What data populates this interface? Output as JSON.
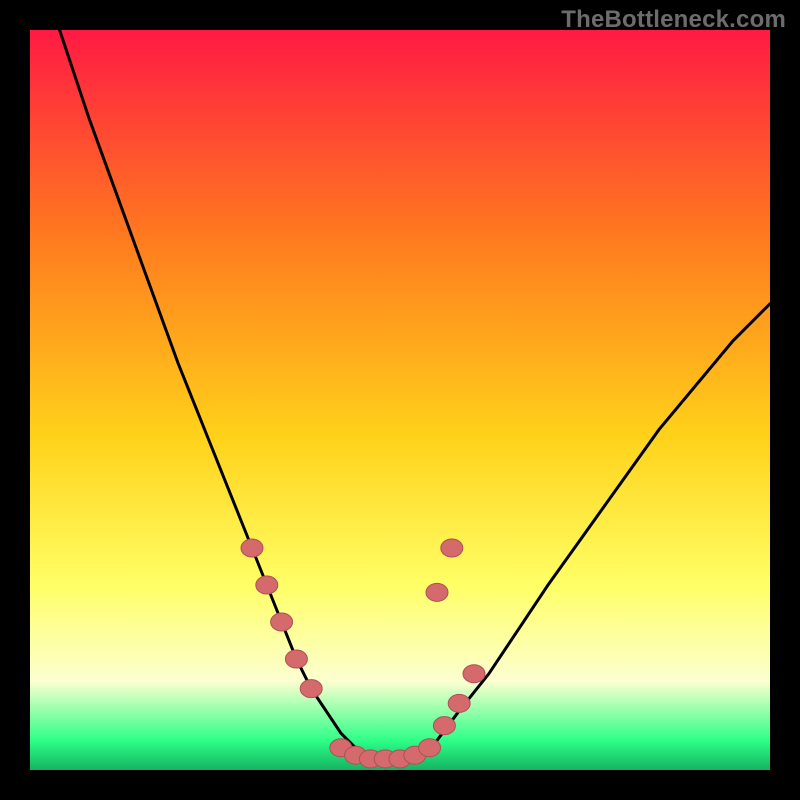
{
  "watermark": "TheBottleneck.com",
  "colors": {
    "gradient_top": "#ff1a44",
    "gradient_mid1": "#ff7a1f",
    "gradient_mid2": "#ffd21a",
    "gradient_mid3": "#ffff66",
    "gradient_mid4": "#fcffd0",
    "gradient_bottom_band": "#2eff87",
    "gradient_bottom_edge": "#14b361",
    "curve": "#000000",
    "marker_fill": "#d46a6b",
    "marker_stroke": "#b04f54"
  },
  "chart_data": {
    "type": "line",
    "title": "",
    "xlabel": "",
    "ylabel": "",
    "xlim": [
      0,
      100
    ],
    "ylim": [
      0,
      100
    ],
    "series": [
      {
        "name": "bottleneck-curve",
        "x": [
          4,
          8,
          12,
          16,
          20,
          24,
          28,
          30,
          32,
          34,
          36,
          38,
          40,
          42,
          44,
          46,
          48,
          50,
          52,
          55,
          58,
          62,
          66,
          70,
          75,
          80,
          85,
          90,
          95,
          100
        ],
        "y": [
          100,
          88,
          77,
          66,
          55,
          45,
          35,
          30,
          25,
          20,
          15,
          11,
          8,
          5,
          3,
          2,
          1.5,
          1.5,
          2,
          4,
          8,
          13,
          19,
          25,
          32,
          39,
          46,
          52,
          58,
          63
        ]
      }
    ],
    "markers": {
      "name": "highlight-points",
      "x": [
        30,
        32,
        34,
        36,
        38,
        42,
        44,
        46,
        48,
        50,
        52,
        54,
        56,
        58,
        60,
        55,
        57
      ],
      "y": [
        30,
        25,
        20,
        15,
        11,
        3,
        2,
        1.5,
        1.5,
        1.5,
        2,
        3,
        6,
        9,
        13,
        24,
        30
      ]
    }
  }
}
